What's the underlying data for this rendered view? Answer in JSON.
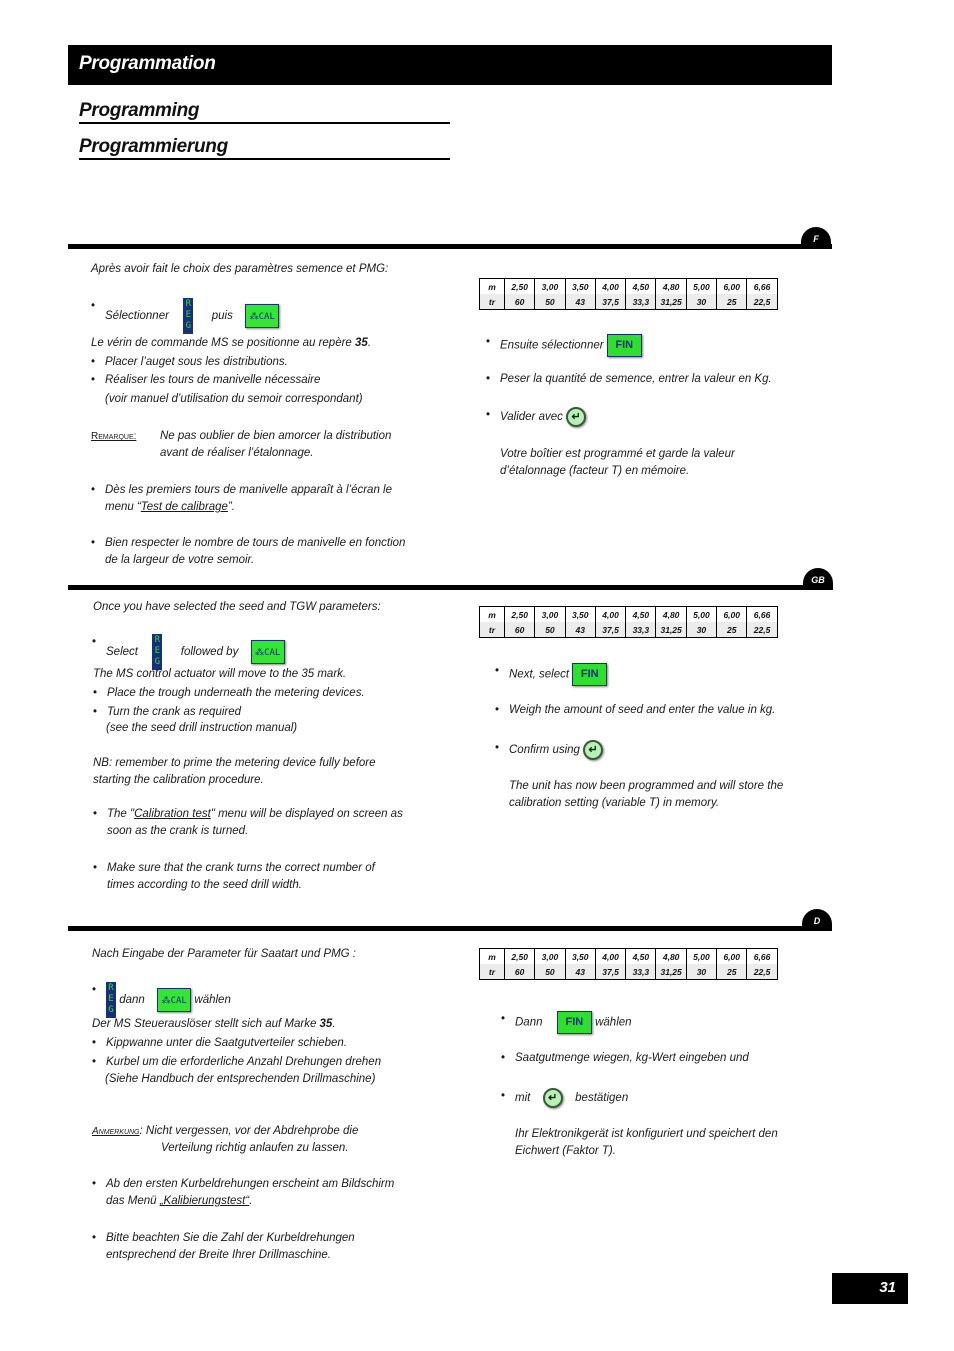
{
  "header": {
    "title_fr": "Programmation",
    "title_gb": "Programming",
    "title_de": "Programmierung"
  },
  "icons": {
    "reg": "REG",
    "cal": "CAL",
    "cal_glyph": "⁂",
    "fin": "FIN",
    "enter": "↵"
  },
  "table": {
    "row1_label": "m",
    "row2_label": "tr",
    "m": [
      "2,50",
      "3,00",
      "3,50",
      "4,00",
      "4,50",
      "4,80",
      "5,00",
      "6,00",
      "6,66"
    ],
    "tr": [
      "60",
      "50",
      "43",
      "37,5",
      "33,3",
      "31,25",
      "30",
      "25",
      "22,5"
    ]
  },
  "sections": {
    "fr": {
      "tab": "F",
      "intro": "Après avoir fait le choix des paramètres semence et PMG:",
      "select_label": "Sélectionner",
      "then_label": "puis",
      "actuator_pre": "Le vérin de commande MS se positionne au repère ",
      "actuator_num": "35",
      "actuator_post": ".",
      "b1": "Placer l’auget sous les distributions.",
      "b2": "Réaliser les tours de manivelle nécessaire",
      "b2b": "(voir manuel d’utilisation du semoir correspondant)",
      "note_label": "Remarque:",
      "note_line1": "Ne pas oublier de bien amorcer la distribution",
      "note_line2": "avant de réaliser l’étalonnage.",
      "b3_pre": "Dès les premiers tours de manivelle apparaît à l’écran le",
      "b3_menu_pre": "menu “",
      "b3_menu": "Test de calibrage",
      "b3_menu_post": "”.",
      "b4_line1": "Bien respecter le nombre de tours de manivelle en fonction",
      "b4_line2": "de la largeur de votre semoir.",
      "r1": "Ensuite sélectionner",
      "r2": "Peser la quantité de semence, entrer la valeur en Kg.",
      "r3": "Valider avec",
      "r4_line1": "Votre boîtier est programmé et garde la valeur",
      "r4_line2": "d’étalonnage (facteur T) en mémoire."
    },
    "gb": {
      "tab": "GB",
      "intro": "Once you have selected the seed and TGW parameters:",
      "select_label": "Select",
      "then_label": "followed by",
      "actuator": "The MS control actuator will  move to the 35 mark.",
      "b1": "Place the trough underneath the metering devices.",
      "b2": "Turn the crank as required",
      "b2b": "(see the seed drill instruction manual)",
      "note_line1": "NB: remember to prime the metering device fully before",
      "note_line2": "starting the calibration procedure.",
      "b3_pre": "The \"",
      "b3_menu": "Calibration test",
      "b3_post": "\" menu will be displayed on screen as",
      "b3_line2": "soon as the crank is turned.",
      "b4_line1": "Make sure that the crank turns the correct number of",
      "b4_line2": "times according to the seed drill width.",
      "r1": "Next, select",
      "r2": "Weigh the amount of seed and enter the value in kg.",
      "r3": "Confirm using",
      "r4_line1": "The unit has now been programmed and will store the",
      "r4_line2": "calibration setting (variable T) in memory."
    },
    "de": {
      "tab": "D",
      "intro": "Nach Eingabe der Parameter für Saatart und PMG :",
      "then_label": "dann",
      "choose_label": "wählen",
      "actuator_pre": "Der MS Steuerauslöser stellt sich auf Marke ",
      "actuator_num": "35",
      "actuator_post": ".",
      "b1": "Kippwanne unter die Saatgutverteiler schieben.",
      "b2": "Kurbel um die erforderliche Anzahl Drehungen drehen",
      "b2b": "(Siehe Handbuch der entsprechenden Drillmaschine)",
      "note_label": "Anmerkung",
      "note_line1": ": Nicht vergessen, vor der Abdrehprobe die",
      "note_line2": "Verteilung richtig anlaufen zu lassen.",
      "b3_line1": "Ab den ersten Kurbeldrehungen erscheint am Bildschirm",
      "b3_menu_pre": "das Menü ",
      "b3_menu": "„Kalibierungstest“",
      "b3_menu_post": ".",
      "b4_line1": "Bitte beachten Sie die Zahl der Kurbeldrehungen",
      "b4_line2": "entsprechend der Breite Ihrer Drillmaschine.",
      "r1_pre": "Dann",
      "r1_post": "wählen",
      "r2": "Saatgutmenge wiegen, kg-Wert eingeben und",
      "r3_pre": "mit",
      "r3_post": "bestätigen",
      "r4_line1": "Ihr Elektronikgerät ist konfiguriert und speichert den",
      "r4_line2": "Eichwert (Faktor T)."
    }
  },
  "page_number": "31"
}
